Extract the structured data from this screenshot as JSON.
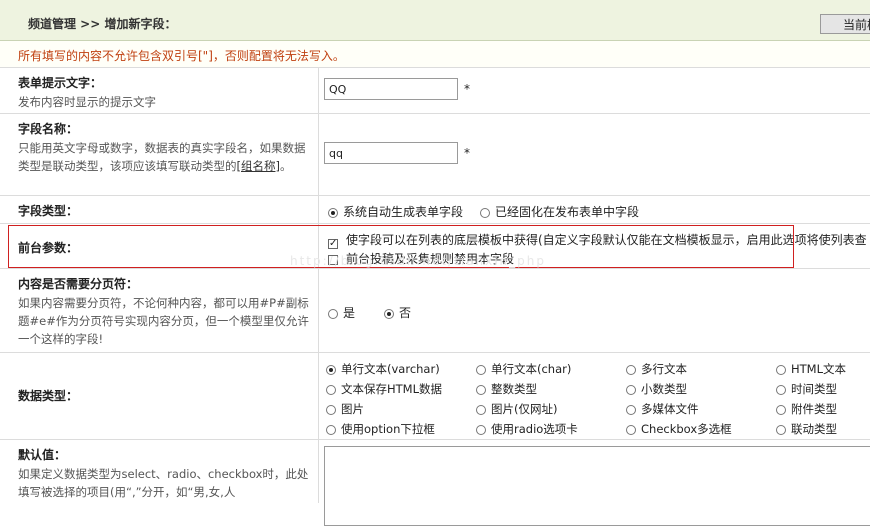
{
  "header": {
    "breadcrumb": "频道管理 >> 增加新字段：",
    "button_label": "当前模"
  },
  "warning": "所有填写的内容不允许包含双引号[\"]，否则配置将无法写入。",
  "form": {
    "prompt_text": {
      "label": "表单提示文字：",
      "desc": "发布内容时显示的提示文字",
      "value": "QQ",
      "required": "*"
    },
    "field_name": {
      "label": "字段名称：",
      "desc": "只能用英文字母或数字，数据表的真实字段名，如果数据类型是联动类型，该项应该填写联动类型的",
      "link": "[组名称]",
      "desc_end": "。",
      "value": "qq",
      "required": "*"
    },
    "field_type": {
      "label": "字段类型：",
      "opt1": "系统自动生成表单字段",
      "opt2": "已经固化在发布表单中字段"
    },
    "frontend": {
      "label": "前台参数：",
      "check1": "使字段可以在列表的底层模板中获得(自定义字段默认仅能在文档模板显示，启用此选项将使列表查",
      "check2": "前台投稿及采集规则禁用本字段",
      "check_mark": "✓"
    },
    "paging": {
      "label": "内容是否需要分页符：",
      "desc": "如果内容需要分页符，不论何种内容，都可以用#P#副标题#e#作为分页符号实现内容分页，但一个模型里仅允许一个这样的字段!",
      "yes": "是",
      "no": "否"
    },
    "data_type": {
      "label": "数据类型：",
      "options": [
        "单行文本(varchar)",
        "单行文本(char)",
        "多行文本",
        "HTML文本",
        "文本保存HTML数据",
        "整数类型",
        "小数类型",
        "时间类型",
        "图片",
        "图片(仅网址)",
        "多媒体文件",
        "附件类型",
        "使用option下拉框",
        "使用radio选项卡",
        "Checkbox多选框",
        "联动类型"
      ]
    },
    "default_value": {
      "label": "默认值：",
      "desc": "如果定义数据类型为select、radio、checkbox时，此处填写被选择的项目(用“,”分开，如“男,女,人"
    }
  },
  "watermark": "http://blog.csdn.net/tianxin_php"
}
